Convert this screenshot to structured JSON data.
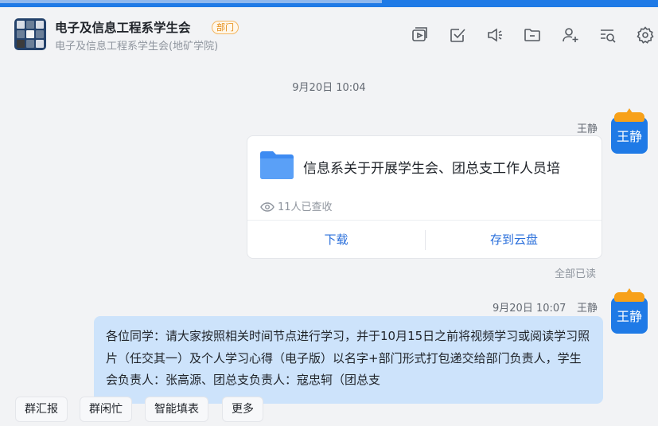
{
  "header": {
    "title": "电子及信息工程系学生会",
    "badge": "部门",
    "subtitle": "电子及信息工程系学生会(地矿学院)",
    "toolbar_icons": [
      "video-icon",
      "task-icon",
      "announcement-icon",
      "folder-icon",
      "add-member-icon",
      "search-messages-icon",
      "settings-icon"
    ]
  },
  "chat": {
    "time_divider": "9月20日 10:04",
    "message1": {
      "sender": "王静",
      "file_name": "信息系关于开展学生会、团总支工作人员培",
      "viewed_text": "11人已查收",
      "download_label": "下载",
      "save_cloud_label": "存到云盘",
      "read_status": "全部已读"
    },
    "message2": {
      "time": "9月20日 10:07",
      "sender": "王静",
      "text": "各位同学：请大家按照相关时间节点进行学习，并于10月15日之前将视频学习或阅读学习照片（任交其一）及个人学习心得（电子版）以名字+部门形式打包递交给部门负责人，学生会负责人：张高源、团总支负责人：寇忠轲（团总支"
    },
    "avatar_text": "王静"
  },
  "quick_actions": [
    "群汇报",
    "群闲忙",
    "智能填表",
    "更多"
  ],
  "colors": {
    "accent": "#1f7ae6",
    "bubble": "#cde3fb",
    "badge": "#e58a10"
  }
}
